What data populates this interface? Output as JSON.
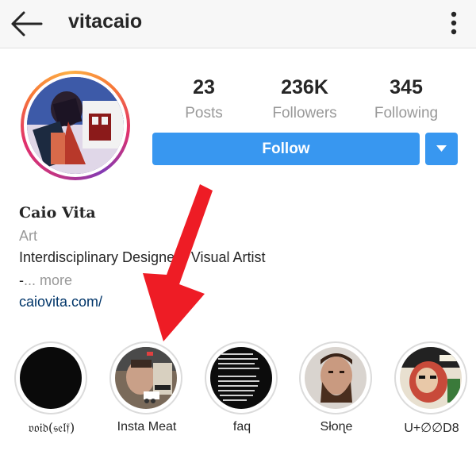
{
  "header": {
    "username": "vitacaio",
    "back_icon": "arrow-left-icon",
    "more_icon": "more-vertical-icon"
  },
  "stats": {
    "posts_count": "23",
    "posts_label": "Posts",
    "followers_count": "236K",
    "followers_label": "Followers",
    "following_count": "345",
    "following_label": "Following"
  },
  "actions": {
    "follow_label": "Follow",
    "dropdown_icon": "caret-down-icon"
  },
  "bio": {
    "name": "Caio Vita",
    "category": "Art",
    "text": "Interdisciplinary Designer ¦ Visual Artist",
    "dash": "-",
    "more": "... more",
    "website": "caiovita.com/"
  },
  "highlights": [
    {
      "label": "𝔳𝔬𝔦𝔡(𝔰𝔢𝔩𝔣)"
    },
    {
      "label": "Insta Meat"
    },
    {
      "label": "faq"
    },
    {
      "label": "Słoɳe"
    },
    {
      "label": "U+∅∅D8"
    }
  ],
  "colors": {
    "follow_blue": "#3897f0",
    "link_blue": "#003569",
    "annotation_red": "#ee1c25",
    "muted_text": "#999999"
  }
}
